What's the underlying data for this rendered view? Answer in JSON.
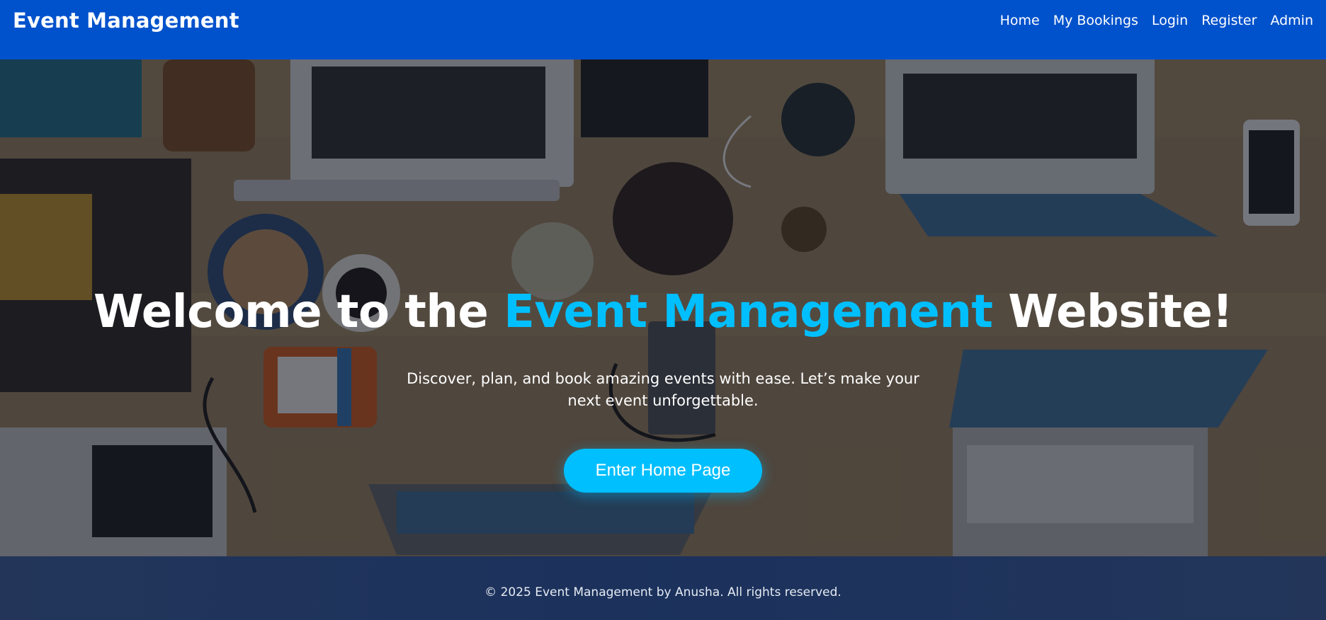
{
  "navbar": {
    "brand": "Event Management",
    "links": [
      {
        "label": "Home"
      },
      {
        "label": "My Bookings"
      },
      {
        "label": "Login"
      },
      {
        "label": "Register"
      },
      {
        "label": "Admin"
      }
    ]
  },
  "hero": {
    "title_part1": "Welcome to the ",
    "title_accent": "Event Management",
    "title_part2": " Website!",
    "subtitle": "Discover, plan, and book amazing events with ease. Let’s make your next event unforgettable.",
    "cta_label": "Enter Home Page"
  },
  "footer": {
    "text": "© 2025 Event Management by Anusha. All rights reserved."
  },
  "colors": {
    "navbar_bg": "#0052cc",
    "accent": "#00bfff",
    "footer_bg": "#1d3460"
  }
}
